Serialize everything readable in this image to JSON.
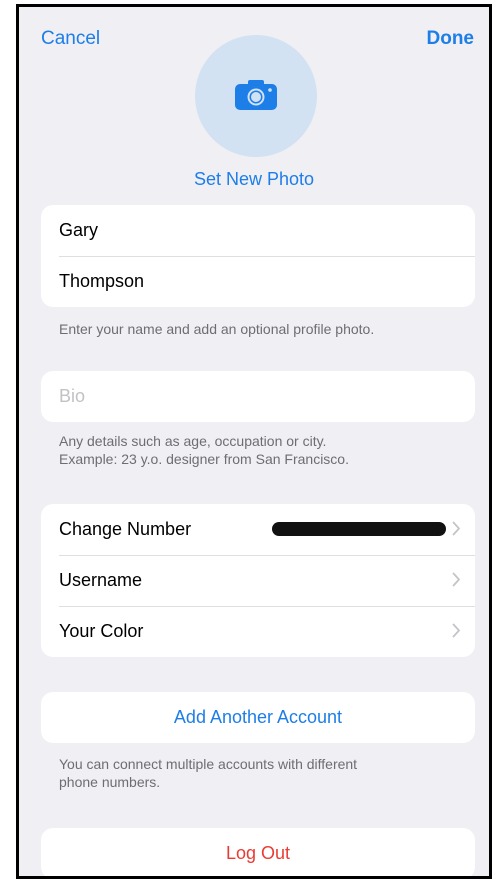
{
  "nav": {
    "cancel_label": "Cancel",
    "done_label": "Done"
  },
  "photo": {
    "icon": "camera-icon",
    "set_label": "Set New Photo"
  },
  "name": {
    "first_name": "Gary",
    "last_name": "Thompson",
    "footnote": "Enter your name and add an optional profile photo."
  },
  "bio": {
    "placeholder": "Bio",
    "footnote_line1": "Any details such as age, occupation or city.",
    "footnote_line2": "Example: 23 y.o. designer from San Francisco."
  },
  "settings": {
    "change_number_label": "Change Number",
    "username_label": "Username",
    "your_color_label": "Your Color",
    "chevron_icon": "chevron-right-icon"
  },
  "account": {
    "add_account_label": "Add Another Account",
    "footnote_line1": "You can connect multiple accounts with different",
    "footnote_line2": "phone numbers."
  },
  "logout": {
    "label": "Log Out"
  },
  "colors": {
    "accent": "#1d7ee8",
    "destructive": "#ea3b33",
    "background": "#efeff4",
    "avatar_background": "#d2e2f3"
  }
}
